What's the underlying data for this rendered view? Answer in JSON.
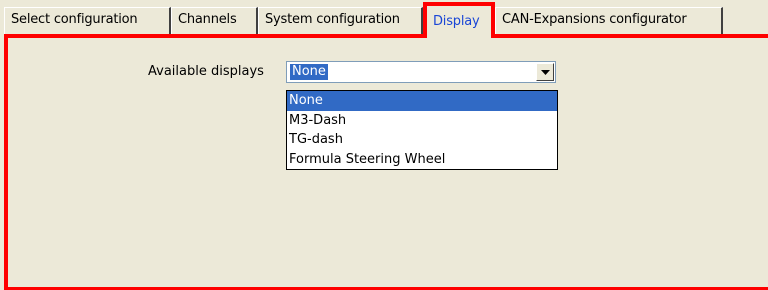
{
  "tabs": [
    {
      "label": "Select configuration",
      "active": false
    },
    {
      "label": "Channels",
      "active": false
    },
    {
      "label": "System configuration",
      "active": false
    },
    {
      "label": "Display",
      "active": true
    },
    {
      "label": "CAN-Expansions configurator",
      "active": false
    }
  ],
  "display": {
    "available_label": "Available displays",
    "selected_value": "None",
    "options": [
      "None",
      "M3-Dash",
      "TG-dash",
      "Formula Steering Wheel"
    ]
  },
  "colors": {
    "highlight": "#ff0000",
    "selection": "#316ac5",
    "active_tab_text": "#1a46d6",
    "background": "#ece9d8"
  }
}
